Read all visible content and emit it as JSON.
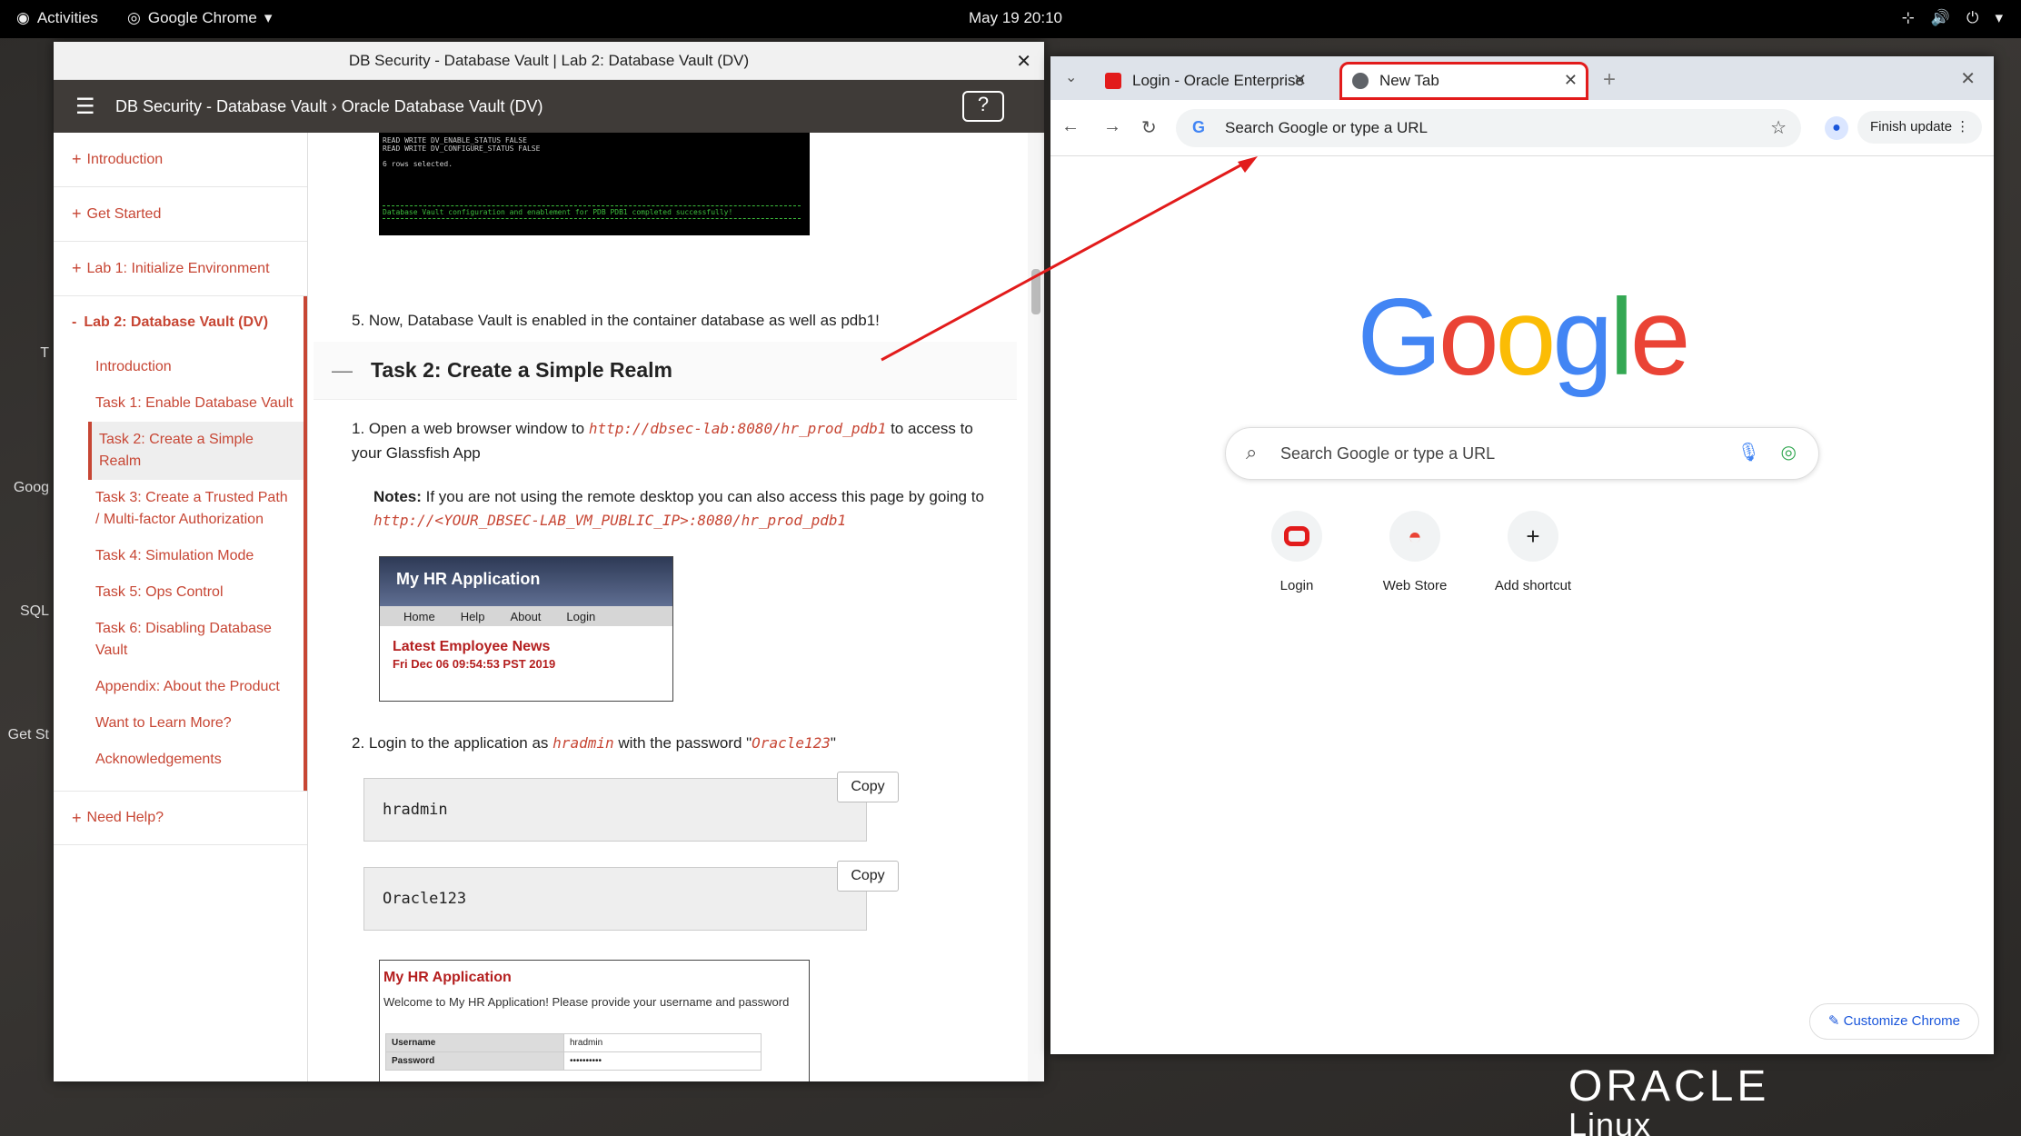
{
  "topbar": {
    "activities": "Activities",
    "app_menu": "Google Chrome",
    "clock": "May 19  20:10"
  },
  "dock": {
    "items": [
      {
        "label": "T"
      },
      {
        "label": "Goog"
      },
      {
        "label": "SQL"
      },
      {
        "label": "Get St"
      }
    ]
  },
  "left_window": {
    "title": "DB Security - Database Vault | Lab 2: Database Vault (DV)",
    "header_title": "DB Security - Database Vault › Oracle Database Vault (DV)",
    "help_icon_text": "?",
    "sidebar": {
      "sections": [
        {
          "label": "Introduction"
        },
        {
          "label": "Get Started"
        },
        {
          "label": "Lab 1: Initialize Environment"
        }
      ],
      "lab2": {
        "label": "Lab 2: Database Vault (DV)",
        "items": [
          {
            "label": "Introduction"
          },
          {
            "label": "Task 1: Enable Database Vault"
          },
          {
            "label": "Task 2: Create a Simple Realm"
          },
          {
            "label": "Task 3: Create a Trusted Path / Multi-factor Authorization"
          },
          {
            "label": "Task 4: Simulation Mode"
          },
          {
            "label": "Task 5: Ops Control"
          },
          {
            "label": "Task 6: Disabling Database Vault"
          },
          {
            "label": "Appendix: About the Product"
          },
          {
            "label": "Want to Learn More?"
          },
          {
            "label": "Acknowledgements"
          }
        ]
      },
      "need_help": "Need Help?"
    },
    "content": {
      "terminal": {
        "line1": "READ WRITE        DV_ENABLE_STATUS        FALSE",
        "line2": "READ WRITE        DV_CONFIGURE_STATUS     FALSE",
        "rows": "6 rows selected.",
        "ok": "Database Vault configuration and enablement for PDB PDB1 completed successfully!"
      },
      "step5": "5. Now, Database Vault is enabled in the container database as well as pdb1!",
      "task_heading": "Task 2: Create a Simple Realm",
      "step1_prefix": "1. Open a web browser window to",
      "step1_url": "http://dbsec-lab:8080/hr_prod_pdb1",
      "step1_suffix": "to access to your Glassfish App",
      "note_label": "Notes:",
      "note_text": "If you are not using the remote desktop you can also access this page by going to",
      "note_url": "http://<YOUR_DBSEC-LAB_VM_PUBLIC_IP>:8080/hr_prod_pdb1",
      "shot1": {
        "banner": "My HR Application",
        "nav": [
          "Home",
          "Help",
          "About",
          "Login"
        ],
        "news": "Latest Employee News",
        "date": "Fri Dec 06 09:54:53 PST 2019"
      },
      "step2_prefix": "2. Login to the application as",
      "step2_user": "hradmin",
      "step2_mid": "with the password \"",
      "step2_pass": "Oracle123",
      "step2_end": "\"",
      "code1": "hradmin",
      "code2": "Oracle123",
      "copy_label": "Copy",
      "shot2": {
        "title": "My HR Application",
        "welcome": "Welcome to My HR Application! Please provide your username and password",
        "username_label": "Username",
        "username_value": "hradmin",
        "password_label": "Password",
        "password_value": "••••••••••"
      }
    }
  },
  "chrome": {
    "tabs": [
      {
        "title": "Login - Oracle Enterprise",
        "favicon_color": "#e21b1b"
      },
      {
        "title": "New Tab",
        "favicon_color": "#5f6368"
      }
    ],
    "omnibox_placeholder": "Search Google or type a URL",
    "finish_update": "Finish update",
    "search_placeholder": "Search Google or type a URL",
    "shortcuts": [
      {
        "label": "Login",
        "icon": "oracle-icon"
      },
      {
        "label": "Web Store",
        "icon": "webstore-icon"
      },
      {
        "label": "Add shortcut",
        "icon": "plus-icon"
      }
    ],
    "customize": "Customize Chrome"
  },
  "branding": {
    "oracle": "ORACLE",
    "linux": "Linux"
  },
  "colors": {
    "oracle_red": "#c74634",
    "highlight_red": "#e21b1b",
    "google_blue": "#4285f4",
    "google_red": "#ea4335",
    "google_yellow": "#fbbc05",
    "google_green": "#34a853"
  }
}
